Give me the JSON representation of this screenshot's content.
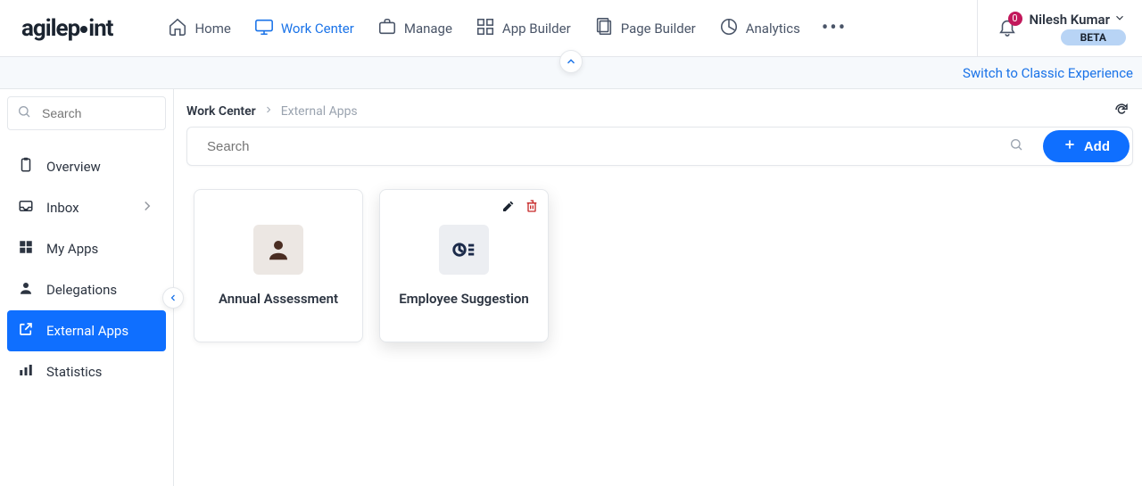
{
  "brand": "agilepoint",
  "nav": {
    "items": [
      {
        "label": "Home"
      },
      {
        "label": "Work Center",
        "active": true
      },
      {
        "label": "Manage"
      },
      {
        "label": "App Builder"
      },
      {
        "label": "Page Builder"
      },
      {
        "label": "Analytics"
      }
    ]
  },
  "notifications": {
    "count": "0"
  },
  "user": {
    "name": "Nilesh Kumar"
  },
  "badge": "BETA",
  "classic_link": "Switch to Classic Experience",
  "sidebar": {
    "search_placeholder": "Search",
    "items": [
      {
        "label": "Overview"
      },
      {
        "label": "Inbox",
        "has_child": true
      },
      {
        "label": "My Apps"
      },
      {
        "label": "Delegations"
      },
      {
        "label": "External Apps",
        "active": true
      },
      {
        "label": "Statistics"
      }
    ]
  },
  "breadcrumb": {
    "root": "Work Center",
    "leaf": "External Apps"
  },
  "toolbar": {
    "search_placeholder": "Search",
    "add_label": "Add"
  },
  "cards": [
    {
      "title": "Annual Assessment"
    },
    {
      "title": "Employee Suggestion",
      "hovered": true
    }
  ]
}
